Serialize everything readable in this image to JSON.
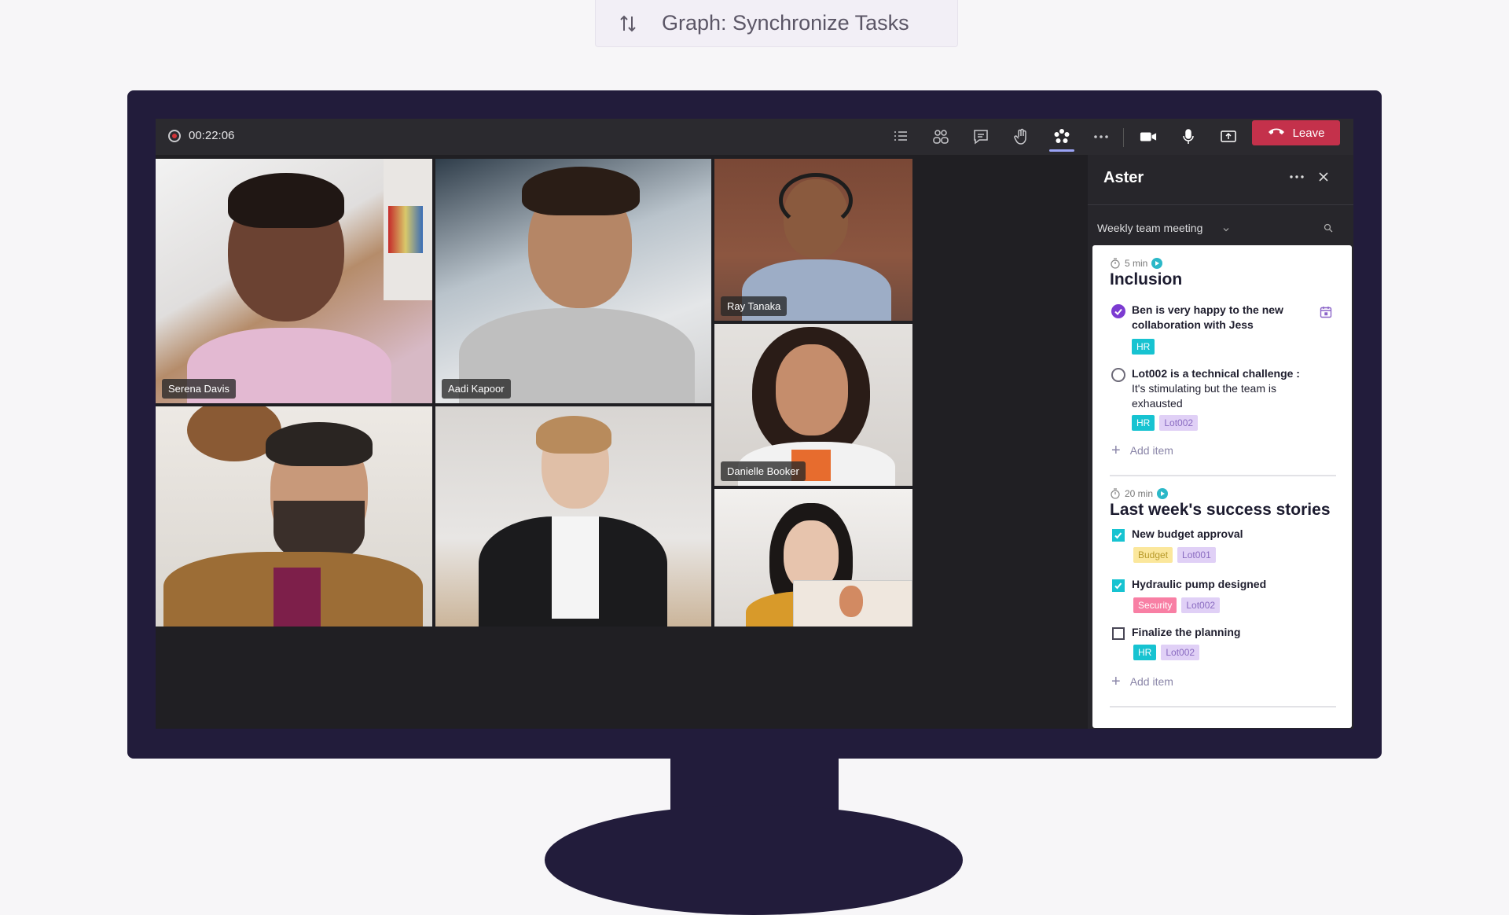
{
  "command_bar": {
    "text": "Graph: Synchronize Tasks"
  },
  "meeting": {
    "timer": "00:22:06",
    "leave_label": "Leave",
    "toolbar_icons": [
      "list-icon",
      "people-icon",
      "chat-icon",
      "raise-hand-icon",
      "aster-app-icon",
      "more-icon",
      "camera-icon",
      "mic-icon",
      "share-screen-icon"
    ]
  },
  "participants": [
    {
      "name": "Serena Davis"
    },
    {
      "name": "Aadi Kapoor"
    },
    {
      "name": "Ray Tanaka"
    },
    {
      "name": "Danielle Booker"
    },
    {
      "name": ""
    },
    {
      "name": ""
    },
    {
      "name": ""
    }
  ],
  "panel": {
    "title": "Aster",
    "meeting_select": "Weekly team meeting",
    "sections": [
      {
        "duration": "5 min",
        "title": "Inclusion",
        "items": [
          {
            "title": "Ben is very happy to the new collaboration with Jess",
            "detail": "",
            "done": true,
            "tags": [
              "HR"
            ]
          },
          {
            "title": "Lot002 is a technical challenge :",
            "detail": "It's stimulating but the team is exhausted",
            "done": false,
            "tags": [
              "HR",
              "Lot002"
            ]
          }
        ],
        "add_label": "Add item"
      },
      {
        "duration": "20 min",
        "title": "Last week's success stories",
        "items": [
          {
            "title": "New budget approval",
            "done": true,
            "tags": [
              "Budget",
              "Lot001"
            ]
          },
          {
            "title": "Hydraulic pump designed",
            "done": true,
            "tags": [
              "Security",
              "Lot002"
            ]
          },
          {
            "title": "Finalize the planning",
            "done": false,
            "tags": [
              "HR",
              "Lot002"
            ]
          }
        ],
        "add_label": "Add item"
      }
    ]
  },
  "colors": {
    "monitor": "#221c3b",
    "leave": "#c4314b",
    "accent_purple": "#7c3bd1",
    "accent_teal": "#17c3d1"
  }
}
